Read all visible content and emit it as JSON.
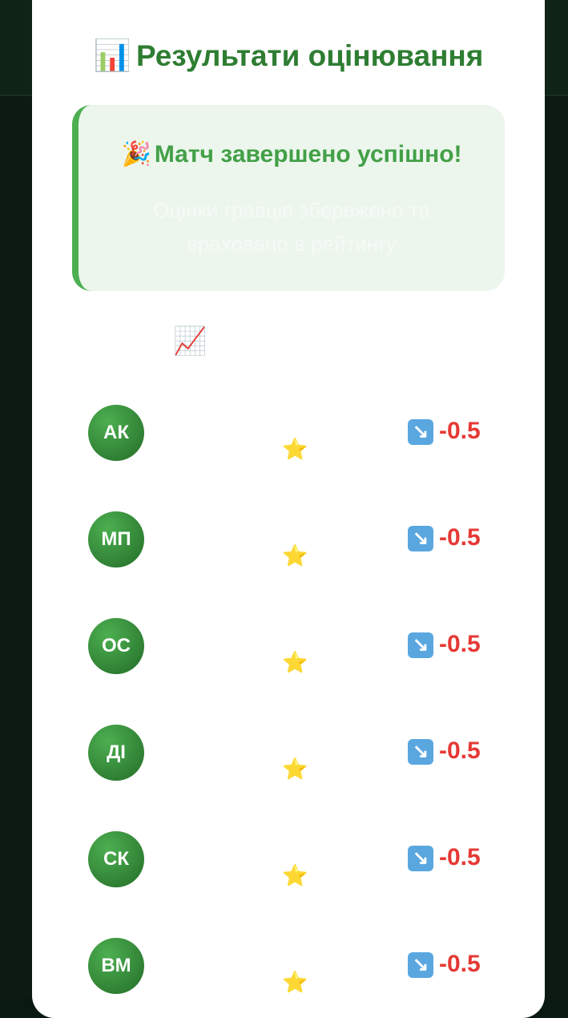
{
  "modal": {
    "title_icon": "📊",
    "title": "Результати оцінювання"
  },
  "success": {
    "icon": "🎉",
    "title": "Матч завершено успішно!",
    "subtitle": "Оцінки гравців збережено та враховано в рейтингу"
  },
  "stats_icon": "📈",
  "players": [
    {
      "initials": "АК",
      "star": "⭐",
      "trend_icon": "↘",
      "delta": "-0.5"
    },
    {
      "initials": "МП",
      "star": "⭐",
      "trend_icon": "↘",
      "delta": "-0.5"
    },
    {
      "initials": "ОС",
      "star": "⭐",
      "trend_icon": "↘",
      "delta": "-0.5"
    },
    {
      "initials": "ДІ",
      "star": "⭐",
      "trend_icon": "↘",
      "delta": "-0.5"
    },
    {
      "initials": "СК",
      "star": "⭐",
      "trend_icon": "↘",
      "delta": "-0.5"
    },
    {
      "initials": "ВМ",
      "star": "⭐",
      "trend_icon": "↘",
      "delta": "-0.5"
    }
  ],
  "colors": {
    "accent_green": "#2e7d32",
    "success_green": "#43a047",
    "negative_red": "#e53935",
    "star_yellow": "#fbc02d"
  }
}
